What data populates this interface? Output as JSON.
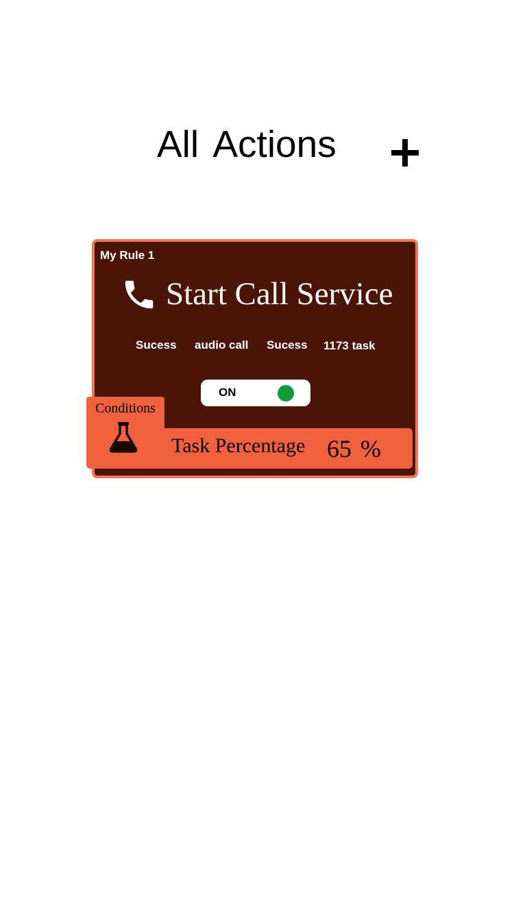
{
  "header": {
    "title": "All Actions",
    "add_icon": "plus-icon"
  },
  "rule_card": {
    "name": "My Rule 1",
    "service_icon": "phone-icon",
    "service_title": "Start Call Service",
    "stats": [
      "Sucess",
      "audio call",
      "Sucess",
      "1173 task"
    ],
    "toggle": {
      "label": "ON",
      "state_color": "#0b9e3a"
    },
    "conditions": {
      "label": "Conditions",
      "icon": "flask-icon"
    },
    "task": {
      "label": "Task Percentage",
      "value": "65 %"
    }
  },
  "colors": {
    "card_background": "#4a1506",
    "card_border": "#f37454",
    "accent": "#f0613c",
    "toggle_on": "#0b9e3a"
  }
}
